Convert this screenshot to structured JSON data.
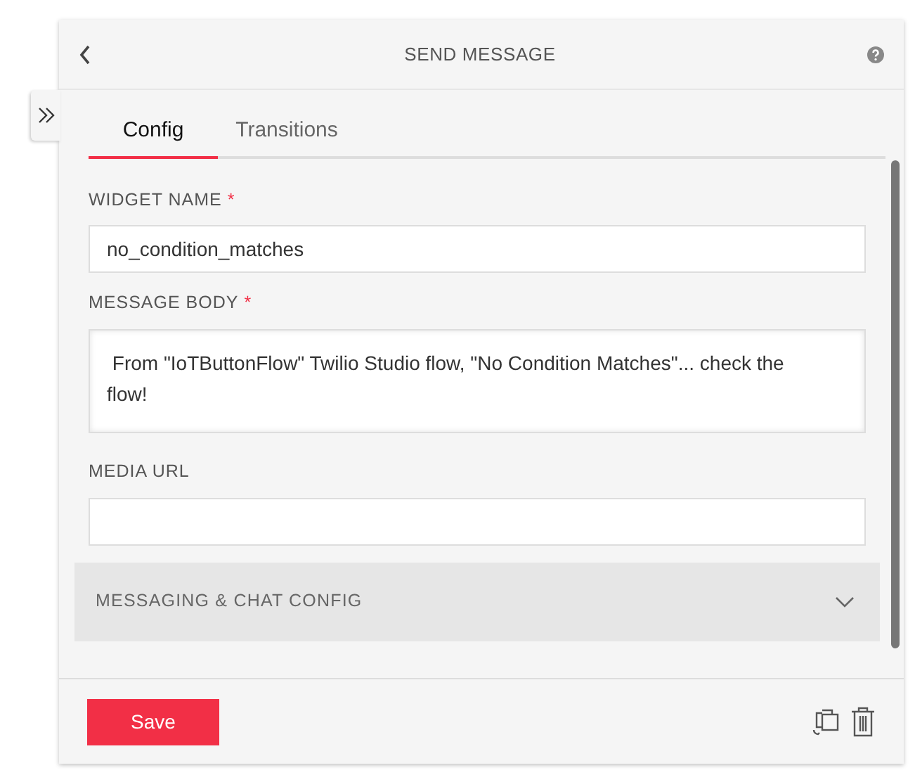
{
  "header": {
    "title": "SEND MESSAGE"
  },
  "tabs": [
    {
      "label": "Config",
      "selected": true
    },
    {
      "label": "Transitions",
      "selected": false
    }
  ],
  "fields": [
    {
      "kind": "input",
      "label": "WIDGET NAME",
      "required_mark": "*",
      "value": "no_condition_matches"
    },
    {
      "kind": "textarea",
      "label": "MESSAGE BODY",
      "required_mark": "*",
      "value": " From \"IoTButtonFlow\" Twilio Studio flow, \"No Condition Matches\"... check the flow!"
    },
    {
      "kind": "input",
      "label": "MEDIA URL"
    }
  ],
  "sections": [
    {
      "label": "MESSAGING & CHAT CONFIG",
      "expanded": false
    }
  ],
  "footer": {
    "save": "Save"
  }
}
